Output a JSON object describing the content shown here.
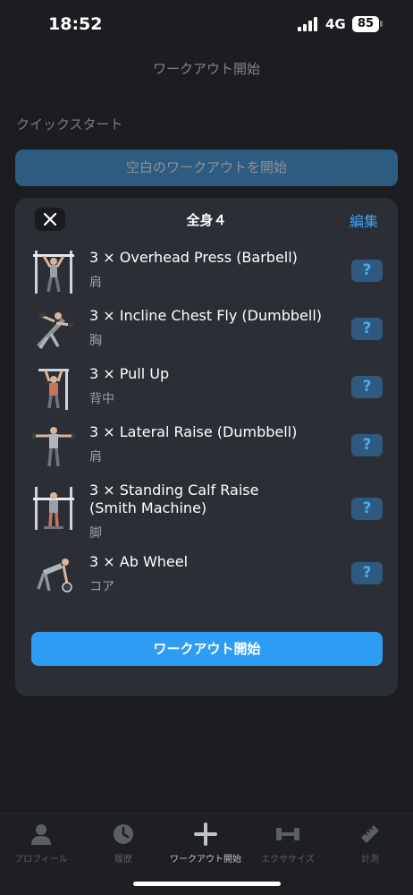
{
  "status_bar": {
    "time": "18:52",
    "network": "4G",
    "battery": "85"
  },
  "background": {
    "nav_title": "ワークアウト開始",
    "quick_start_label": "クイックスタート",
    "empty_workout_button": "空白のワークアウトを開始"
  },
  "modal": {
    "title": "全身４",
    "edit_label": "編集",
    "help_label": "?",
    "start_button": "ワークアウト開始",
    "exercises": [
      {
        "name": "3 × Overhead Press (Barbell)",
        "muscle": "肩",
        "icon": "overhead-press-figure"
      },
      {
        "name": "3 × Incline Chest Fly (Dumbbell)",
        "muscle": "胸",
        "icon": "incline-chest-fly-figure"
      },
      {
        "name": "3 × Pull Up",
        "muscle": "背中",
        "icon": "pull-up-figure"
      },
      {
        "name": "3 × Lateral Raise (Dumbbell)",
        "muscle": "肩",
        "icon": "lateral-raise-figure"
      },
      {
        "name": "3 × Standing Calf Raise (Smith Machine)",
        "name_line1": "3 × Standing Calf Raise",
        "name_line2": "(Smith Machine)",
        "muscle": "脚",
        "icon": "calf-raise-figure"
      },
      {
        "name": "3 × Ab Wheel",
        "muscle": "コア",
        "icon": "ab-wheel-figure"
      }
    ]
  },
  "tab_bar": {
    "tabs": [
      {
        "label": "プロフィール",
        "icon": "person-icon",
        "active": false
      },
      {
        "label": "履歴",
        "icon": "clock-icon",
        "active": false
      },
      {
        "label": "ワークアウト開始",
        "icon": "plus-icon",
        "active": true
      },
      {
        "label": "エクササイズ",
        "icon": "dumbbell-icon",
        "active": false
      },
      {
        "label": "計測",
        "icon": "ruler-icon",
        "active": false
      }
    ]
  },
  "colors": {
    "accent": "#2f9cf3",
    "modal_bg": "#2b2e35",
    "page_bg": "#1c1d21"
  }
}
